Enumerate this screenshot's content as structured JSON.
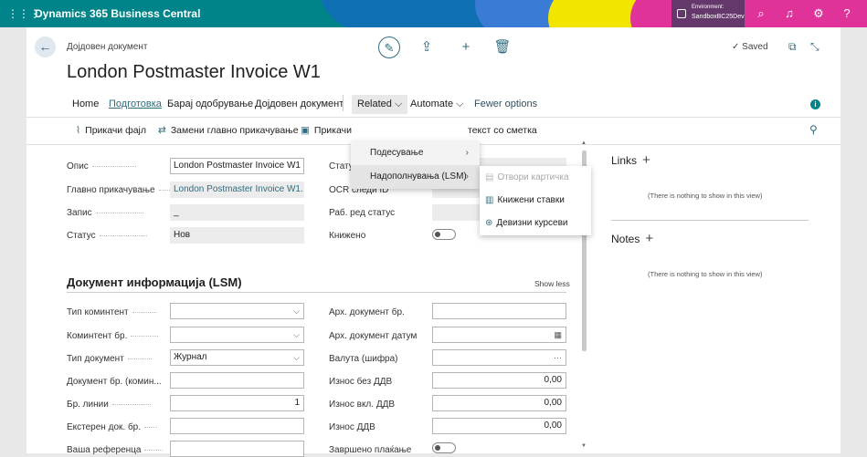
{
  "app": {
    "title": "Dynamics 365 Business Central"
  },
  "environment": {
    "label": "Environment:",
    "name": "SandboxBC25Dev"
  },
  "page": {
    "caption": "Дојдовен документ",
    "title": "London Postmaster Invoice W1",
    "saved_label": "Saved"
  },
  "menu": {
    "home": "Home",
    "prepare": "Подготовка",
    "request_approval": "Барај одобрување",
    "incoming_document": "Дојдовен документ",
    "related": "Related",
    "automate": "Automate",
    "fewer_options": "Fewer options"
  },
  "subactions": {
    "attach_file": "Прикачи фајл",
    "replace_main": "Замени главно прикачување",
    "attach_partial": "Прикачи",
    "text_account": "текст со сметка"
  },
  "related_menu": {
    "items": [
      {
        "label": "Подесување"
      },
      {
        "label": "Надополнувања (LSM)"
      }
    ]
  },
  "submenu": {
    "items": [
      {
        "label": "Отвори картичка"
      },
      {
        "label": "Книжени ставки"
      },
      {
        "label": "Девизни курсеви"
      }
    ]
  },
  "general": {
    "description_label": "Опис",
    "description_value": "London Postmaster Invoice W1",
    "main_attachment_label": "Главно прикачување",
    "main_attachment_value": "London Postmaster Invoice W1...",
    "record_label": "Запис",
    "record_value": "_",
    "status_label": "Статус",
    "status_value": "Нов",
    "ocr_status_label": "Статус на OCR",
    "ocr_tracking_label": "OCR следи ID",
    "job_queue_label": "Раб. ред статус",
    "posted_label": "Книжено"
  },
  "section": {
    "title": "Документ информација (LSM)",
    "show_less": "Show less"
  },
  "docinfo": {
    "entity_type_label": "Тип коминтент",
    "entity_no_label": "Коминтент бр.",
    "doc_type_label": "Тип документ",
    "doc_type_value": "Журнал",
    "doc_no_label": "Документ бр. (комин...",
    "line_no_label": "Бр. линии",
    "line_no_value": "1",
    "ext_doc_label": "Екстерен док. бр.",
    "your_ref_label": "Ваша референца",
    "arch_doc_no_label": "Арх. документ бр.",
    "arch_doc_date_label": "Арх. документ датум",
    "currency_label": "Валута (шифра)",
    "amount_excl_label": "Износ без ДДВ",
    "amount_excl_value": "0,00",
    "amount_incl_label": "Износ вкл. ДДВ",
    "amount_incl_value": "0,00",
    "vat_label": "Износ ДДВ",
    "vat_value": "0,00",
    "paid_label": "Завршено плаќање"
  },
  "factbox": {
    "links_title": "Links",
    "links_empty": "(There is nothing to show in this view)",
    "notes_title": "Notes",
    "notes_empty": "(There is nothing to show in this view)"
  },
  "colors": {
    "topbar": "#008489",
    "accent": "#2f6c7f"
  }
}
